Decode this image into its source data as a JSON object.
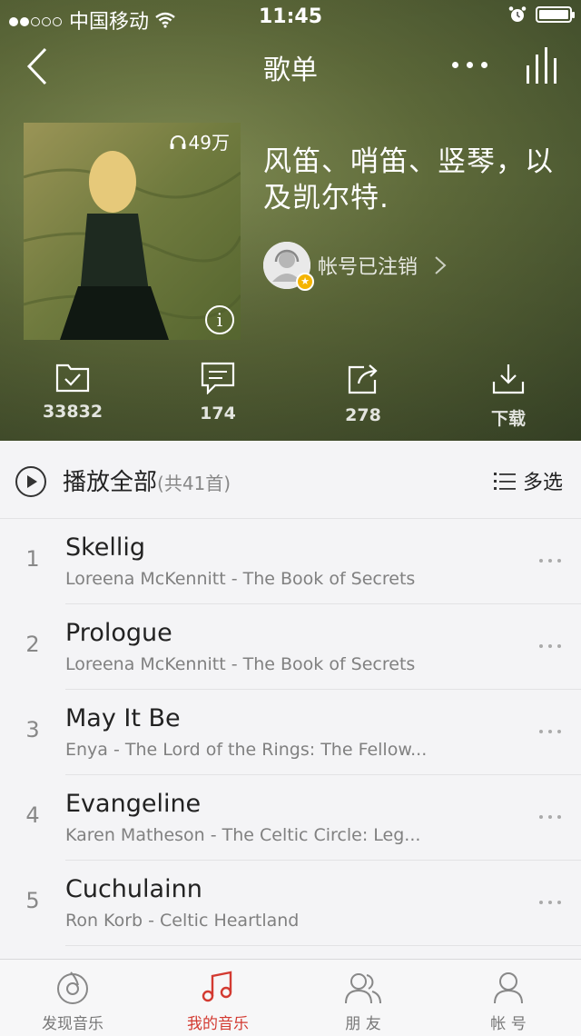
{
  "status_bar": {
    "carrier": "中国移动",
    "time": "11:45"
  },
  "nav": {
    "title": "歌单"
  },
  "playlist": {
    "cover_play_count": "49万",
    "title": "风笛、哨笛、竖琴，以及凯尔特.",
    "creator": "帐号已注销"
  },
  "actions": [
    {
      "icon": "folder-check-icon",
      "label": "33832"
    },
    {
      "icon": "comment-icon",
      "label": "174"
    },
    {
      "icon": "share-icon",
      "label": "278"
    },
    {
      "icon": "download-icon",
      "label": "下载"
    }
  ],
  "play_all": {
    "label": "播放全部",
    "count": "(共41首)",
    "multi_select": "多选"
  },
  "songs": [
    {
      "index": "1",
      "title": "Skellig",
      "subtitle": "Loreena McKennitt - The Book of Secrets"
    },
    {
      "index": "2",
      "title": "Prologue",
      "subtitle": "Loreena McKennitt - The Book of Secrets"
    },
    {
      "index": "3",
      "title": "May It Be",
      "subtitle": "Enya - The Lord of the Rings: The Fellow..."
    },
    {
      "index": "4",
      "title": "Evangeline",
      "subtitle": "Karen Matheson - The Celtic Circle: Leg..."
    },
    {
      "index": "5",
      "title": "Cuchulainn",
      "subtitle": "Ron Korb - Celtic Heartland"
    }
  ],
  "tabbar": [
    {
      "icon": "discover-music-icon",
      "label": "发现音乐",
      "active": false
    },
    {
      "icon": "music-note-icon",
      "label": "我的音乐",
      "active": true
    },
    {
      "icon": "friends-icon",
      "label": "朋 友",
      "active": false
    },
    {
      "icon": "account-icon",
      "label": "帐 号",
      "active": false
    }
  ],
  "colors": {
    "accent": "#d33a31",
    "header_bg": "#5e6a3a"
  }
}
